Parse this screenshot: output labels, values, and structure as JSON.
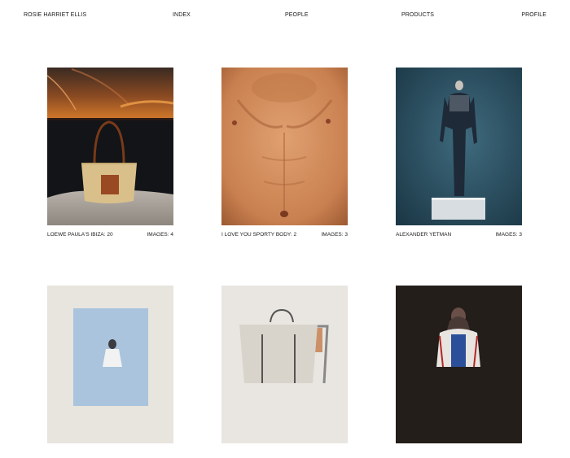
{
  "nav": {
    "logo": "ROSIE HARRIET ELLIS",
    "index": "INDEX",
    "people": "PEOPLE",
    "products": "PRODUCTS",
    "profile": "PROFILE"
  },
  "projects": [
    {
      "title": "LOEWE PAULA'S IBIZA: 20",
      "count": "IMAGES: 4"
    },
    {
      "title": "I LOVE YOU SPORTY BODY: 2",
      "count": "IMAGES: 3"
    },
    {
      "title": "ALEXANDER YETMAN",
      "count": "IMAGES: 3"
    },
    {
      "title": "",
      "count": ""
    },
    {
      "title": "",
      "count": ""
    },
    {
      "title": "",
      "count": ""
    }
  ]
}
